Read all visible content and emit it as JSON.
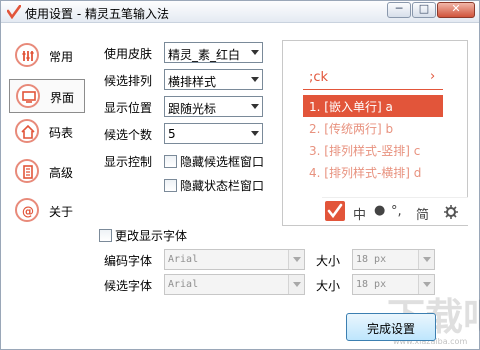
{
  "window": {
    "title": "使用设置 - 精灵五笔输入法",
    "buttons": {
      "minimize": "─",
      "maximize": "□",
      "close": "✕"
    }
  },
  "sidebar": {
    "items": [
      {
        "label": "常用",
        "icon": "sliders-icon",
        "active": false
      },
      {
        "label": "界面",
        "icon": "monitor-icon",
        "active": true
      },
      {
        "label": "码表",
        "icon": "home-icon",
        "active": false
      },
      {
        "label": "高级",
        "icon": "document-icon",
        "active": false
      },
      {
        "label": "关于",
        "icon": "at-icon",
        "active": false
      }
    ]
  },
  "settings": {
    "skin": {
      "label": "使用皮肤",
      "value": "精灵_素_红白"
    },
    "layout": {
      "label": "候选排列",
      "value": "横排样式"
    },
    "position": {
      "label": "显示位置",
      "value": "跟随光标"
    },
    "count": {
      "label": "候选个数",
      "value": "5"
    },
    "display_control": {
      "label": "显示控制",
      "hide_candidate": {
        "label": "隐藏候选框窗口",
        "checked": false
      },
      "hide_status": {
        "label": "隐藏状态栏窗口",
        "checked": false
      }
    }
  },
  "font": {
    "change_label": "更改显示字体",
    "change_checked": false,
    "code_font": {
      "label": "编码字体",
      "value": "Arial",
      "size_label": "大小",
      "size_value": "18 px"
    },
    "cand_font": {
      "label": "候选字体",
      "value": "Arial",
      "size_label": "大小",
      "size_value": "18 px"
    }
  },
  "preview": {
    "code": ";ck",
    "more": "›",
    "candidates": [
      {
        "text": "1. [嵌入单行] a",
        "selected": true
      },
      {
        "text": "2. [传统两行] b",
        "selected": false
      },
      {
        "text": "3. [排列样式-竖排] c",
        "selected": false
      },
      {
        "text": "4. [排列样式-横排] d",
        "selected": false
      }
    ],
    "status_bar": {
      "lang": "中",
      "dot": "●",
      "punct": "°,",
      "mode": "简"
    },
    "accent": "#e2553a"
  },
  "actions": {
    "done": "完成设置"
  },
  "watermark": {
    "main": "下载吧",
    "small": "www.xiazaiba.com"
  }
}
